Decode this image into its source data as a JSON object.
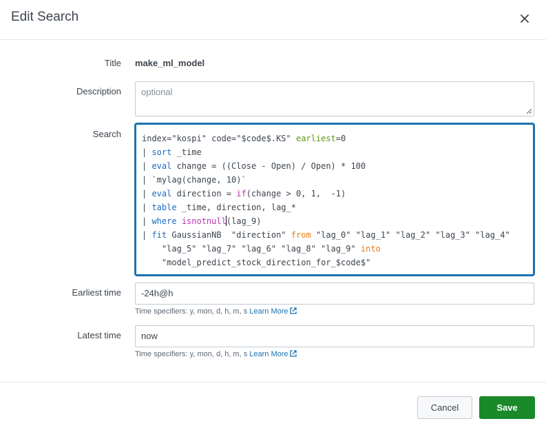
{
  "dialog": {
    "title": "Edit Search"
  },
  "form": {
    "title_label": "Title",
    "title_value": "make_ml_model",
    "description_label": "Description",
    "description_placeholder": "optional",
    "search_label": "Search",
    "search_lines": [
      "index=\"kospi\" code=\"$code$.KS\" earliest=0",
      "| sort _time",
      "| eval change = ((Close - Open) / Open) * 100",
      "| `mylag(change, 10)`",
      "| eval direction = if(change > 0, 1,  -1)",
      "| table _time, direction, lag_*",
      "| where isnotnull(lag_9)",
      "| fit GaussianNB  \"direction\" from \"lag_0\" \"lag_1\" \"lag_2\" \"lag_3\" \"lag_4\"",
      "    \"lag_5\" \"lag_7\" \"lag_6\" \"lag_8\" \"lag_9\" into",
      "    \"model_predict_stock_direction_for_$code$\""
    ],
    "earliest_label": "Earliest time",
    "earliest_value": "-24h@h",
    "latest_label": "Latest time",
    "latest_value": "now",
    "time_help": "Time specifiers: y, mon, d, h, m, s",
    "learn_more": "Learn More"
  },
  "footer": {
    "cancel_label": "Cancel",
    "save_label": "Save"
  },
  "colors": {
    "accent": "#1a72ae",
    "save": "#1a8929",
    "keyword": "#1b6bc4",
    "function": "#bf2fb7",
    "operator": "#e97d16",
    "argument": "#5a9a0f"
  },
  "icons": {
    "close": "close-icon",
    "external_link": "external-link-icon",
    "resize": "resize-handle-icon"
  }
}
